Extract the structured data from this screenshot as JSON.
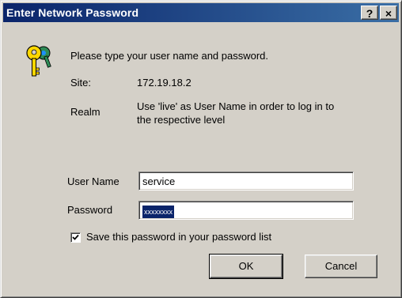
{
  "window": {
    "title": "Enter Network Password",
    "help_label": "?",
    "close_label": "×"
  },
  "dialog": {
    "prompt": "Please type your user name and password.",
    "site_label": "Site:",
    "site_value": "172.19.18.2",
    "realm_label": "Realm",
    "realm_value_line1": "Use 'live' as User Name in order to log in to",
    "realm_value_line2": "the respective level",
    "username_label": "User Name",
    "username_value": "service",
    "password_label": "Password",
    "password_value": "xxxxxxxx",
    "save_checkbox_label": "Save this password in your password list",
    "save_checked": true
  },
  "buttons": {
    "ok": "OK",
    "cancel": "Cancel"
  },
  "icons": {
    "dialog_icon": "keys-icon",
    "checkbox_mark": "checkmark-icon"
  },
  "colors": {
    "titlebar": "#0a246a",
    "dialog_bg": "#d4d0c8",
    "selection": "#0a246a"
  }
}
